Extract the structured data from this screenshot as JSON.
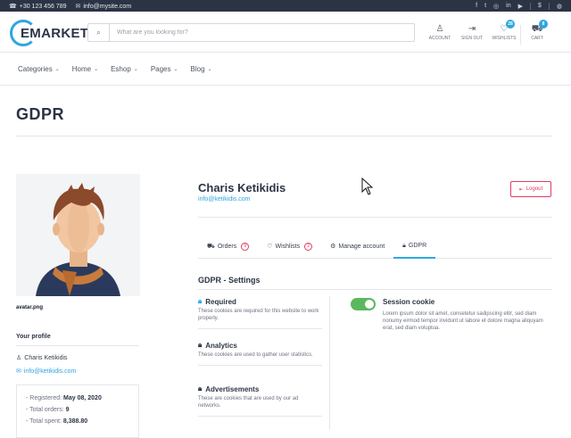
{
  "topbar": {
    "phone": "+30 123 456 789",
    "email": "info@mysite.com",
    "social_icons": [
      "facebook-icon",
      "twitter-icon",
      "instagram-icon",
      "linkedin-icon",
      "youtube-icon"
    ],
    "currency_symbol": "$"
  },
  "header": {
    "logo_text": "EMARKET",
    "search_placeholder": "What are you looking for?",
    "icons": {
      "account": "ACCOUNT",
      "signout": "SIGN OUT",
      "wishlists": "WISHLISTS",
      "wishlists_count": "28",
      "cart": "CART",
      "cart_count": "8"
    }
  },
  "nav": {
    "items": [
      {
        "label": "Categories"
      },
      {
        "label": "Home"
      },
      {
        "label": "Eshop"
      },
      {
        "label": "Pages"
      },
      {
        "label": "Blog"
      }
    ]
  },
  "page": {
    "title": "GDPR"
  },
  "sidebar": {
    "avatar_caption": "avatar.png",
    "your_profile": "Your profile",
    "name": "Charis Ketikidis",
    "email": "info@ketikidis.com",
    "stats": {
      "registered_label": "- Registered:",
      "registered_value": "May 08, 2020",
      "orders_label": "- Total orders:",
      "orders_value": "9",
      "spent_label": "- Total spent:",
      "spent_value": "8,388.80"
    }
  },
  "user": {
    "name": "Charis Ketikidis",
    "email": "info@ketikidis.com",
    "logout_label": "Logout"
  },
  "tabs": [
    {
      "label": "Orders",
      "count": "9"
    },
    {
      "label": "Wishlists",
      "count": "2"
    },
    {
      "label": "Manage account"
    },
    {
      "label": "GDPR"
    }
  ],
  "gdpr": {
    "title": "GDPR - Settings",
    "cookies": [
      {
        "title": "Required",
        "desc": "These cookies are required for this website to work properly."
      },
      {
        "title": "Analytics",
        "desc": "These cookies are used to gather user statistics."
      },
      {
        "title": "Advertisements",
        "desc": "These are cookies that are used by our ad networks."
      }
    ],
    "session": {
      "title": "Session cookie",
      "desc": "Lorem ipsum dolor sit amet, consetetur sadipscing elitr, sed diam nonumy eirmod tempor invidunt ut labore et dolore magna aliquyam erat, sed diam voluptua.",
      "enabled": true
    }
  },
  "colors": {
    "accent": "#2fa6df",
    "danger": "#e23b5f",
    "toggle_on": "#5cb85c",
    "topbar_bg": "#2b3445"
  }
}
